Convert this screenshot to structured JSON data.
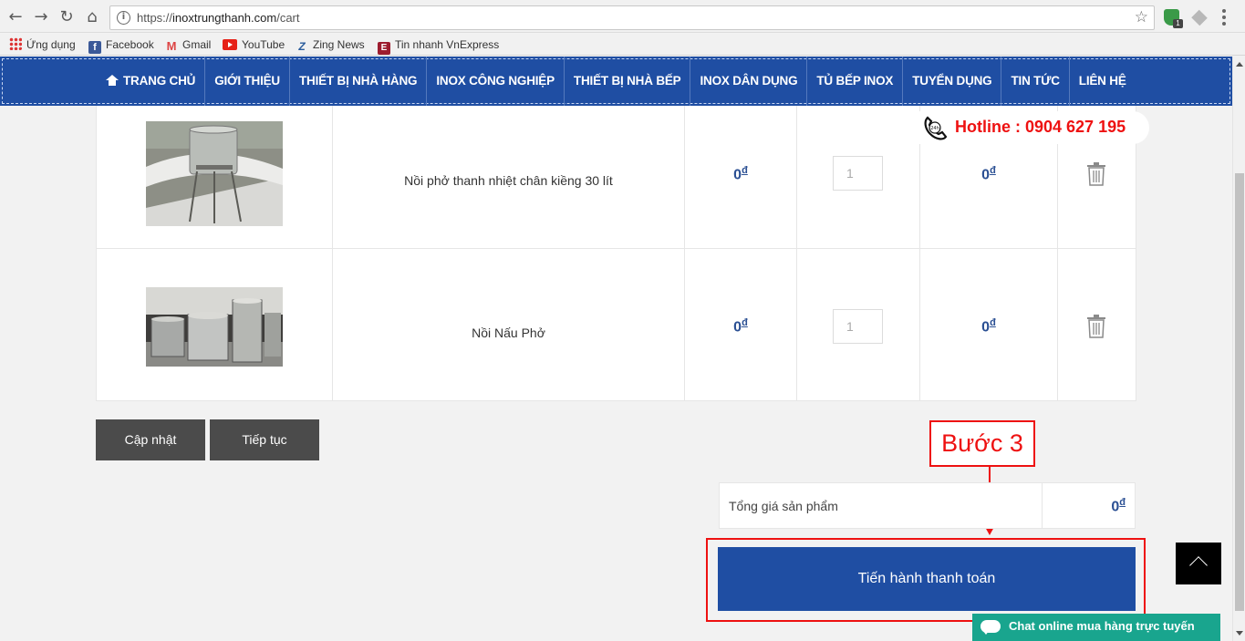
{
  "browser": {
    "url_scheme": "https://",
    "url_host": "inoxtrungthanh.com",
    "url_path": "/cart",
    "back_icon": "arrow-left-icon",
    "forward_icon": "arrow-right-icon",
    "reload_icon": "reload-icon",
    "home_icon": "home-icon",
    "info_icon": "i",
    "star_icon": "☆",
    "extension_badge": "1"
  },
  "bookmarks": [
    {
      "label": "Ứng dụng",
      "icon": "apps-icon"
    },
    {
      "label": "Facebook",
      "icon": "facebook-icon",
      "glyph": "f"
    },
    {
      "label": "Gmail",
      "icon": "gmail-icon",
      "glyph": "M"
    },
    {
      "label": "YouTube",
      "icon": "youtube-icon"
    },
    {
      "label": "Zing News",
      "icon": "zing-icon",
      "glyph": "Z"
    },
    {
      "label": "Tin nhanh VnExpress",
      "icon": "vnexpress-icon",
      "glyph": "E"
    }
  ],
  "nav": {
    "items": [
      "TRANG CHỦ",
      "GIỚI THIỆU",
      "THIẾT BỊ NHÀ HÀNG",
      "INOX CÔNG NGHIỆP",
      "THIẾT BỊ NHÀ BẾP",
      "INOX DÂN DỤNG",
      "TỦ BẾP INOX",
      "TUYỂN DỤNG",
      "TIN TỨC",
      "LIÊN HỆ"
    ]
  },
  "hotline": "Hotline : 0904 627 195",
  "cart": {
    "items": [
      {
        "name": "Nồi phở thanh nhiệt chân kiềng 30 lít",
        "price": "0",
        "currency": "đ",
        "quantity": "1",
        "total": "0"
      },
      {
        "name": "Nồi Nấu Phở",
        "price": "0",
        "currency": "đ",
        "quantity": "1",
        "total": "0"
      }
    ],
    "update_button": "Cập nhật",
    "continue_button": "Tiếp tục",
    "subtotal_label": "Tổng giá sản phẩm",
    "subtotal_value": "0",
    "currency": "đ",
    "checkout_button": "Tiến hành thanh toán"
  },
  "annotation": {
    "step_label": "Bước 3",
    "color": "#e11111"
  },
  "chat": {
    "label": "Chat online mua hàng trực tuyến"
  },
  "colors": {
    "brand_blue": "#1f4ea3",
    "price_blue": "#2a4f93",
    "chat_green": "#19a58e",
    "hotline_red": "#e11111"
  }
}
